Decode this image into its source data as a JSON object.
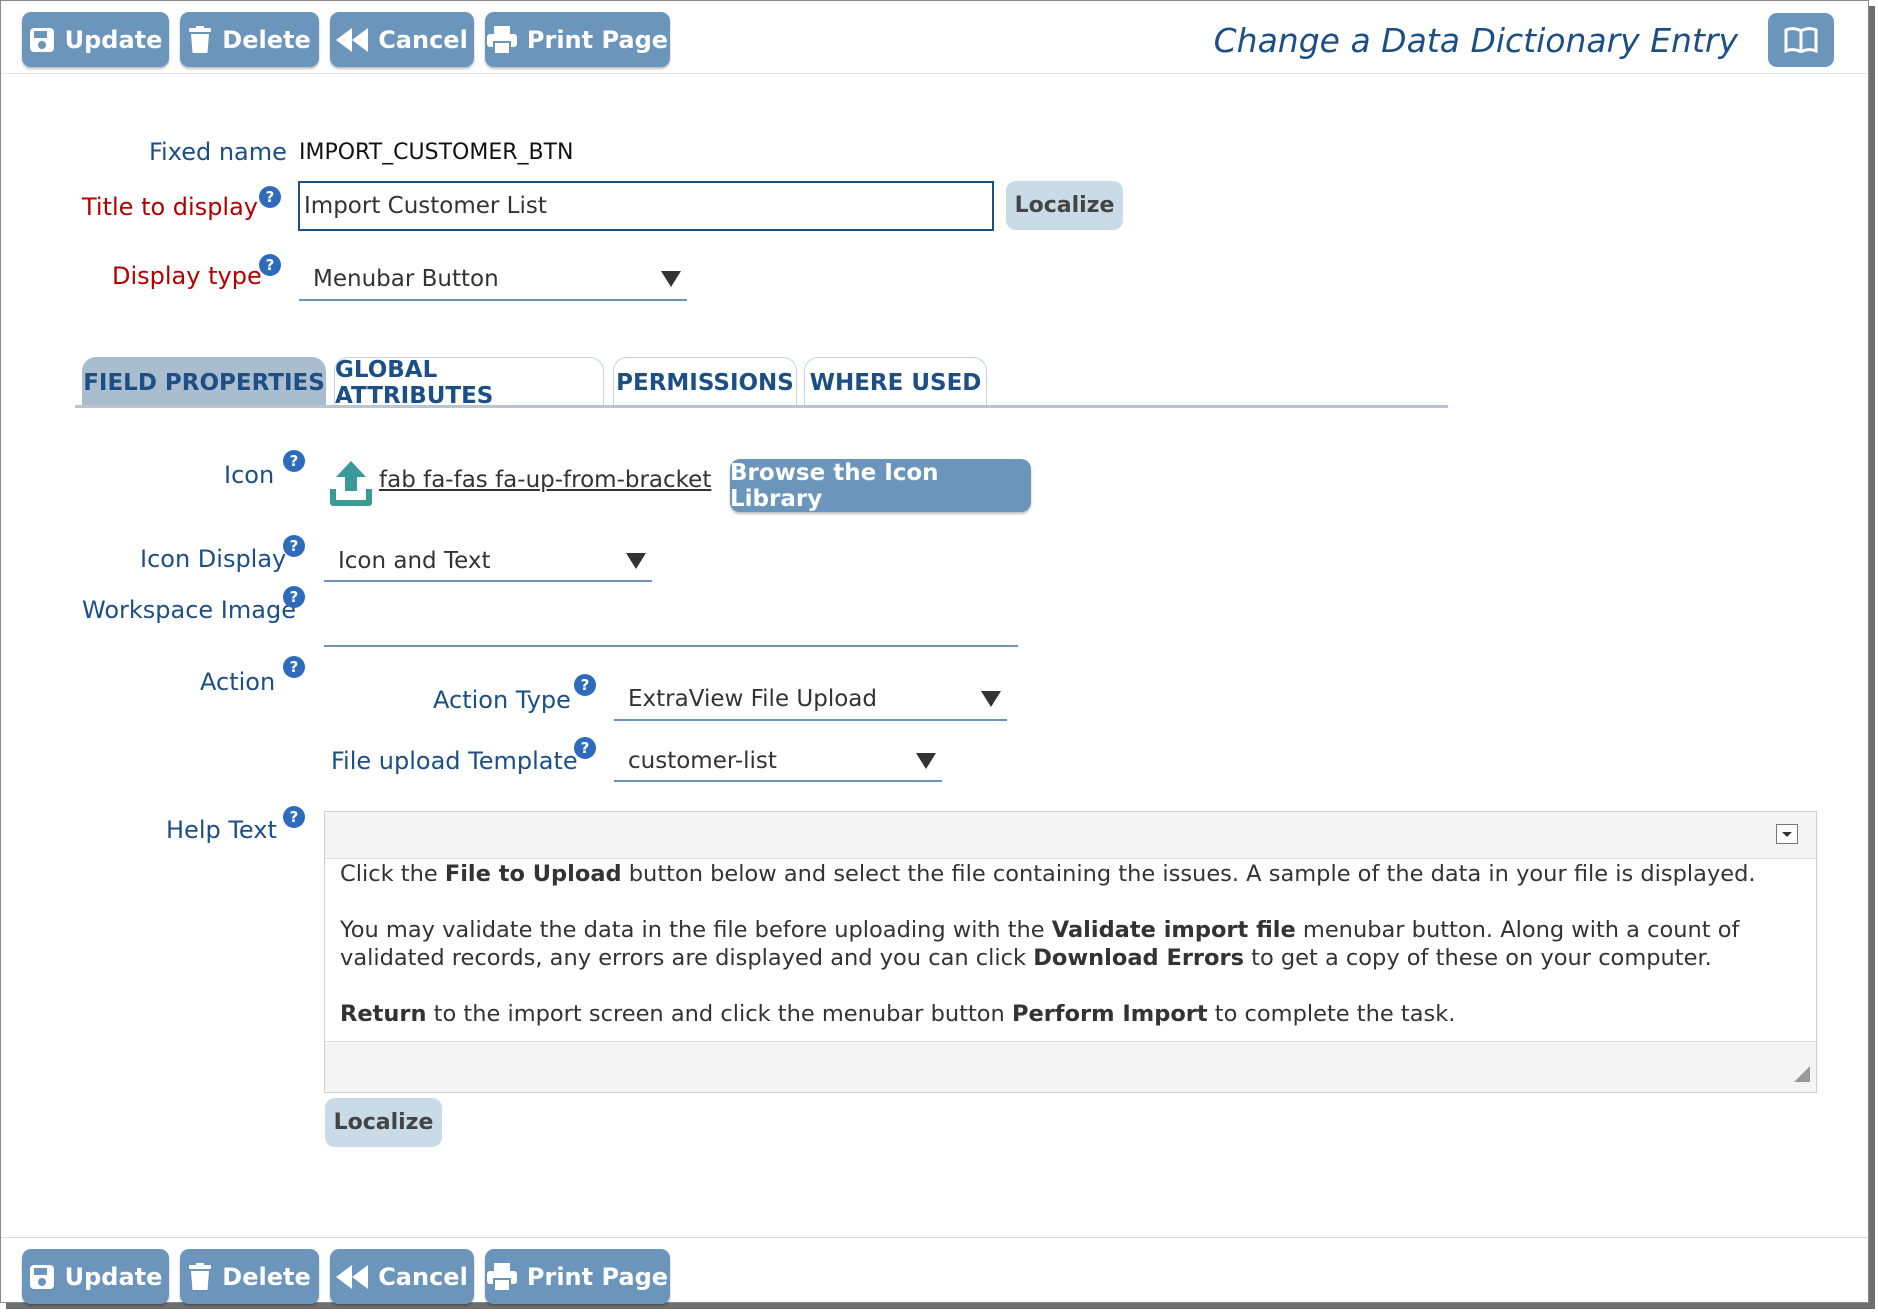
{
  "toolbar": {
    "update": "Update",
    "delete": "Delete",
    "cancel": "Cancel",
    "print": "Print Page"
  },
  "page": {
    "title": "Change a Data Dictionary Entry"
  },
  "fields": {
    "fixed_name_label": "Fixed name",
    "fixed_name_value": "IMPORT_CUSTOMER_BTN",
    "title_label": "Title to display",
    "title_value": "Import Customer List",
    "localize": "Localize",
    "display_type_label": "Display type",
    "display_type_value": "Menubar Button"
  },
  "tabs": [
    "FIELD PROPERTIES",
    "GLOBAL ATTRIBUTES",
    "PERMISSIONS",
    "WHERE USED"
  ],
  "properties": {
    "icon_label": "Icon",
    "icon_value": "fab fa-fas fa-up-from-bracket",
    "browse_button": "Browse the Icon Library",
    "icon_display_label": "Icon Display",
    "icon_display_value": "Icon and Text",
    "workspace_image_label": "Workspace Image",
    "workspace_image_value": "",
    "action_label": "Action",
    "action_type_label": "Action Type",
    "action_type_value": "ExtraView File Upload",
    "file_upload_label": "File upload Template",
    "file_upload_value": "customer-list",
    "help_text_label": "Help Text",
    "help_localize": "Localize"
  },
  "help_text": {
    "p1_a": "Click the ",
    "p1_b": "File to Upload",
    "p1_c": " button below and select the file containing the issues.  A sample of the data in your file is displayed.",
    "p2_a": "You may validate the data in the file before uploading with the ",
    "p2_b": "Validate import file",
    "p2_c": " menubar button.  Along with a count of validated records, any errors are displayed and you can click ",
    "p2_d": "Download Errors",
    "p2_e": " to get a copy of these on your computer.",
    "p3_a": "Return",
    "p3_b": " to the import screen and click the menubar button ",
    "p3_c": "Perform Import",
    "p3_d": " to complete the task."
  },
  "colors": {
    "button": "#6b95bb",
    "label_blue": "#1c4f86",
    "label_required": "#b30000",
    "tab_active": "#aabdcf",
    "help_icon": "#2f6bbd",
    "upload_icon": "#3a9a9a"
  },
  "icons": [
    "save-icon",
    "trash-icon",
    "backward-icon",
    "print-icon",
    "book-icon",
    "upload-icon",
    "help-icon"
  ]
}
